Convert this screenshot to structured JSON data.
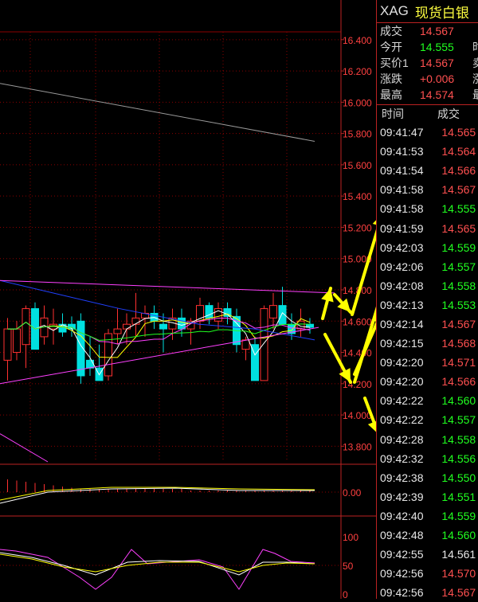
{
  "quote_panel": {
    "symbol": "XAG",
    "name": "现货白银",
    "rows": [
      {
        "label": "成交",
        "value": "14.567",
        "color": "red",
        "trunc": ""
      },
      {
        "label": "今开",
        "value": "14.555",
        "color": "green",
        "trunc": "时"
      },
      {
        "label": "买价1",
        "value": "14.567",
        "color": "red",
        "trunc": "卖"
      },
      {
        "label": "涨跌",
        "value": "+0.006",
        "color": "red",
        "trunc": "涨"
      },
      {
        "label": "最高",
        "value": "14.574",
        "color": "red",
        "trunc": "最"
      }
    ],
    "trade_headers": {
      "time": "时间",
      "price": "成交"
    },
    "trades": [
      {
        "time": "09:41:47",
        "price": "14.565",
        "color": "red"
      },
      {
        "time": "09:41:53",
        "price": "14.564",
        "color": "red"
      },
      {
        "time": "09:41:54",
        "price": "14.566",
        "color": "red"
      },
      {
        "time": "09:41:58",
        "price": "14.567",
        "color": "red"
      },
      {
        "time": "09:41:58",
        "price": "14.555",
        "color": "green"
      },
      {
        "time": "09:41:59",
        "price": "14.565",
        "color": "red"
      },
      {
        "time": "09:42:03",
        "price": "14.559",
        "color": "green"
      },
      {
        "time": "09:42:06",
        "price": "14.557",
        "color": "green"
      },
      {
        "time": "09:42:08",
        "price": "14.558",
        "color": "green"
      },
      {
        "time": "09:42:13",
        "price": "14.553",
        "color": "green"
      },
      {
        "time": "09:42:14",
        "price": "14.567",
        "color": "red"
      },
      {
        "time": "09:42:15",
        "price": "14.568",
        "color": "red"
      },
      {
        "time": "09:42:20",
        "price": "14.571",
        "color": "red"
      },
      {
        "time": "09:42:20",
        "price": "14.566",
        "color": "red"
      },
      {
        "time": "09:42:22",
        "price": "14.560",
        "color": "green"
      },
      {
        "time": "09:42:22",
        "price": "14.557",
        "color": "green"
      },
      {
        "time": "09:42:28",
        "price": "14.558",
        "color": "green"
      },
      {
        "time": "09:42:32",
        "price": "14.556",
        "color": "green"
      },
      {
        "time": "09:42:38",
        "price": "14.550",
        "color": "green"
      },
      {
        "time": "09:42:39",
        "price": "14.551",
        "color": "green"
      },
      {
        "time": "09:42:40",
        "price": "14.559",
        "color": "green"
      },
      {
        "time": "09:42:48",
        "price": "14.560",
        "color": "green"
      },
      {
        "time": "09:42:55",
        "price": "14.561",
        "color": "white"
      },
      {
        "time": "09:42:56",
        "price": "14.570",
        "color": "red"
      },
      {
        "time": "09:42:56",
        "price": "14.567",
        "color": "red"
      }
    ]
  },
  "colors": {
    "up": "#ff3030",
    "down": "#00e0e0",
    "grid": "#8b0000",
    "axis_text": "#ff4040",
    "arrow": "#ffff00"
  },
  "chart_data": [
    {
      "type": "candlestick",
      "ylim": [
        13.7,
        16.45
      ],
      "yticks": [
        "16.400",
        "16.200",
        "16.000",
        "15.800",
        "15.600",
        "15.400",
        "15.200",
        "15.000",
        "14.800",
        "14.600",
        "14.400",
        "14.200",
        "14.000",
        "13.800"
      ],
      "candles": [
        {
          "o": 14.35,
          "h": 14.62,
          "l": 14.22,
          "c": 14.55
        },
        {
          "o": 14.4,
          "h": 14.6,
          "l": 14.35,
          "c": 14.55
        },
        {
          "o": 14.45,
          "h": 14.7,
          "l": 14.3,
          "c": 14.68
        },
        {
          "o": 14.68,
          "h": 14.72,
          "l": 14.5,
          "c": 14.42
        },
        {
          "o": 14.5,
          "h": 14.7,
          "l": 14.45,
          "c": 14.62
        },
        {
          "o": 14.55,
          "h": 14.68,
          "l": 14.45,
          "c": 14.58
        },
        {
          "o": 14.58,
          "h": 14.65,
          "l": 14.5,
          "c": 14.53
        },
        {
          "o": 14.58,
          "h": 14.63,
          "l": 14.5,
          "c": 14.55
        },
        {
          "o": 14.6,
          "h": 14.65,
          "l": 14.2,
          "c": 14.25
        },
        {
          "o": 14.35,
          "h": 14.5,
          "l": 14.25,
          "c": 14.3
        },
        {
          "o": 14.3,
          "h": 14.45,
          "l": 14.22,
          "c": 14.22
        },
        {
          "o": 14.25,
          "h": 14.55,
          "l": 14.22,
          "c": 14.52
        },
        {
          "o": 14.52,
          "h": 14.68,
          "l": 14.45,
          "c": 14.55
        },
        {
          "o": 14.55,
          "h": 14.65,
          "l": 14.45,
          "c": 14.58
        },
        {
          "o": 14.58,
          "h": 14.78,
          "l": 14.5,
          "c": 14.62
        },
        {
          "o": 14.62,
          "h": 14.7,
          "l": 14.5,
          "c": 14.65
        },
        {
          "o": 14.65,
          "h": 14.7,
          "l": 14.55,
          "c": 14.6
        },
        {
          "o": 14.58,
          "h": 14.65,
          "l": 14.4,
          "c": 14.55
        },
        {
          "o": 14.55,
          "h": 14.68,
          "l": 14.48,
          "c": 14.62
        },
        {
          "o": 14.62,
          "h": 14.68,
          "l": 14.5,
          "c": 14.55
        },
        {
          "o": 14.55,
          "h": 14.62,
          "l": 14.45,
          "c": 14.6
        },
        {
          "o": 14.6,
          "h": 14.75,
          "l": 14.55,
          "c": 14.7
        },
        {
          "o": 14.7,
          "h": 14.72,
          "l": 14.58,
          "c": 14.62
        },
        {
          "o": 14.6,
          "h": 14.72,
          "l": 14.55,
          "c": 14.68
        },
        {
          "o": 14.68,
          "h": 14.72,
          "l": 14.58,
          "c": 14.63
        },
        {
          "o": 14.63,
          "h": 14.68,
          "l": 14.4,
          "c": 14.45
        },
        {
          "o": 14.42,
          "h": 14.5,
          "l": 14.35,
          "c": 14.48
        },
        {
          "o": 14.45,
          "h": 14.5,
          "l": 14.22,
          "c": 14.22
        },
        {
          "o": 14.22,
          "h": 14.7,
          "l": 14.22,
          "c": 14.68
        },
        {
          "o": 14.62,
          "h": 14.78,
          "l": 14.55,
          "c": 14.7
        },
        {
          "o": 14.7,
          "h": 14.82,
          "l": 14.6,
          "c": 14.58
        },
        {
          "o": 14.58,
          "h": 14.65,
          "l": 14.48,
          "c": 14.52
        },
        {
          "o": 14.55,
          "h": 14.68,
          "l": 14.5,
          "c": 14.6
        },
        {
          "o": 14.58,
          "h": 14.62,
          "l": 14.52,
          "c": 14.56
        }
      ]
    },
    {
      "type": "bar",
      "ylim": [
        -0.1,
        0.3
      ],
      "yticks": [
        "0.00"
      ]
    },
    {
      "type": "line",
      "ylim": [
        0,
        100
      ],
      "yticks": [
        "100",
        "50",
        "0"
      ]
    }
  ]
}
